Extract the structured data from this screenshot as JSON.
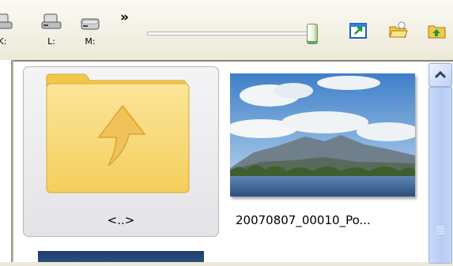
{
  "toolbar": {
    "drives": [
      {
        "label": "K:"
      },
      {
        "label": "L:"
      },
      {
        "label": "M:"
      }
    ],
    "overflow_chevron": "»",
    "thumbnail_size_slider": {
      "value": 1.0
    },
    "icons": [
      "new-window-icon",
      "open-folder-icon",
      "up-folder-icon"
    ]
  },
  "files": [
    {
      "name": "<..>",
      "type": "parent-folder"
    },
    {
      "name": "20070807_00010_Po...",
      "type": "image"
    }
  ],
  "colors": {
    "folder": "#f7d56f",
    "selection_bg": "#e8e8ec",
    "scrollbar": "#b6cbf4"
  }
}
